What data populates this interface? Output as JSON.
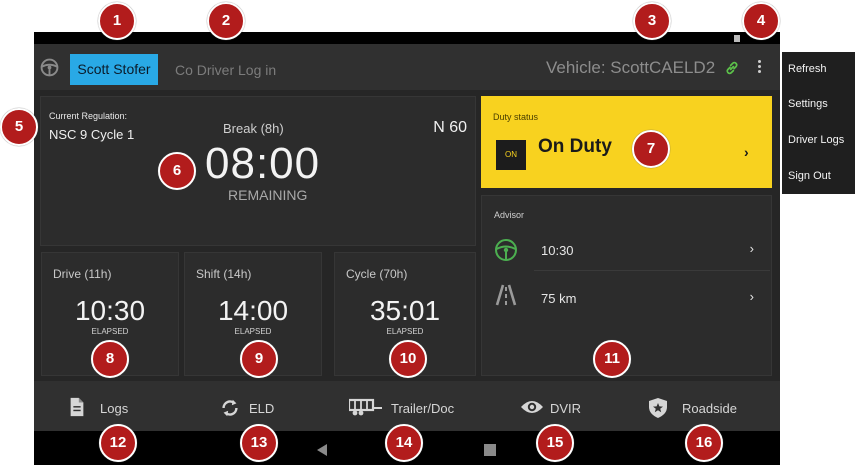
{
  "top_bar": {
    "driver_button": "Scott Stofer",
    "co_driver_login": "Co Driver Log in",
    "vehicle": "Vehicle: ScottCAELD2"
  },
  "menu": {
    "items": [
      "Refresh",
      "Settings",
      "Driver Logs",
      "Sign Out"
    ]
  },
  "regulation": {
    "label": "Current Regulation:",
    "value": "NSC 9 Cycle 1",
    "break_title": "Break (8h)",
    "zone": "N 60",
    "time": "08:00",
    "status": "REMAINING"
  },
  "timers": [
    {
      "title": "Drive (11h)",
      "value": "10:30",
      "status": "ELAPSED"
    },
    {
      "title": "Shift (14h)",
      "value": "14:00",
      "status": "ELAPSED"
    },
    {
      "title": "Cycle (70h)",
      "value": "35:01",
      "status": "ELAPSED"
    }
  ],
  "duty_status": {
    "label": "Duty status",
    "badge": "ON",
    "value": "On Duty",
    "chevron": "›"
  },
  "advisor": {
    "label": "Advisor",
    "rows": [
      {
        "icon": "steering-wheel-icon",
        "value": "10:30",
        "chevron": "›"
      },
      {
        "icon": "road-icon",
        "value": "75 km",
        "chevron": "›"
      }
    ]
  },
  "bottom_nav": {
    "items": [
      {
        "label": "Logs",
        "icon": "document-icon"
      },
      {
        "label": "ELD",
        "icon": "sync-icon"
      },
      {
        "label": "Trailer/Doc",
        "icon": "trailer-icon"
      },
      {
        "label": "DVIR",
        "icon": "eye-icon"
      },
      {
        "label": "Roadside",
        "icon": "shield-star-icon"
      }
    ]
  },
  "callouts": [
    "1",
    "2",
    "3",
    "4",
    "5",
    "6",
    "7",
    "8",
    "9",
    "10",
    "11",
    "12",
    "13",
    "14",
    "15",
    "16"
  ],
  "colors": {
    "accent_blue": "#29a9e6",
    "duty_yellow": "#f8d21f",
    "link_green": "#4caf50",
    "advisor_green": "#4caf50",
    "callout_red": "#b21c1c",
    "screen_background": "#262626"
  }
}
